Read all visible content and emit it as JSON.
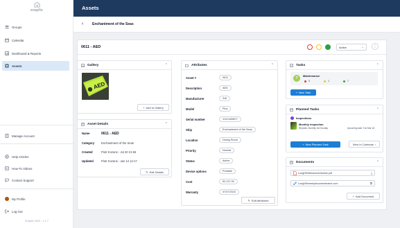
{
  "brand": {
    "name": "snapfix"
  },
  "sidebar": {
    "items": [
      {
        "label": "Groups",
        "icon": "groups-icon"
      },
      {
        "label": "Calendar",
        "icon": "calendar-icon"
      },
      {
        "label": "Dashboard & Reports",
        "icon": "dashboard-icon"
      },
      {
        "label": "Assets",
        "icon": "assets-icon",
        "active": true
      }
    ],
    "bottom_items": [
      {
        "label": "Manage Account",
        "icon": "building-icon"
      },
      {
        "label": "Help Articles",
        "icon": "help-icon"
      },
      {
        "label": "How-To Videos",
        "icon": "video-icon"
      },
      {
        "label": "Contact Support",
        "icon": "support-icon"
      },
      {
        "label": "My Profile",
        "icon": "avatar"
      },
      {
        "label": "Log Out",
        "icon": "logout-icon"
      }
    ],
    "version": "Snapfix 2023 - 1.1.7"
  },
  "header": {
    "title": "Assets"
  },
  "breadcrumb": {
    "title": "Enchantment of the Seas"
  },
  "asset": {
    "id": "0611 - AED",
    "status": "Active",
    "status_colors": [
      "#e53935",
      "#f5c518",
      "#2e9e44"
    ]
  },
  "gallery": {
    "title": "Gallery",
    "image_label": "AED",
    "add_button": "Add to Gallery"
  },
  "details": {
    "title": "Asset Details",
    "rows": [
      {
        "key": "Name",
        "value": "0611 - AED"
      },
      {
        "key": "Category",
        "value": "Enchantment of the Seas"
      },
      {
        "key": "Created",
        "value": "Piotr Kozans - Jul 20 21:56"
      },
      {
        "key": "Updated",
        "value": "Piotr Kozans - Jan 12 12:17"
      }
    ],
    "edit_button": "Edit Details"
  },
  "attributes": {
    "title": "Attributes",
    "rows": [
      {
        "key": "Asset #",
        "value": "0611"
      },
      {
        "key": "Description",
        "value": "AED"
      },
      {
        "key": "Manufacturer",
        "value": "Zoll"
      },
      {
        "key": "Model",
        "value": "Plus"
      },
      {
        "key": "Serial number",
        "value": "X11C489677"
      },
      {
        "key": "Ship",
        "value": "Enchantment of the Seas"
      },
      {
        "key": "Location",
        "value": "Dining Room"
      },
      {
        "key": "Priority",
        "value": "Normal"
      },
      {
        "key": "Status",
        "value": "Active"
      },
      {
        "key": "Device options",
        "value": "Portable"
      },
      {
        "key": "Cost",
        "value": "€2,137.90"
      },
      {
        "key": "Warranty",
        "value": "07/07/2023"
      }
    ],
    "edit_button": "Edit Attributes"
  },
  "tasks": {
    "title": "Tasks",
    "card_title": "Maintenance",
    "counts": [
      {
        "color": "#e53935",
        "value": "0"
      },
      {
        "color": "#f5c518",
        "value": "1"
      },
      {
        "color": "#2e9e44",
        "value": "7"
      }
    ],
    "new_button": "New Task"
  },
  "planned": {
    "title": "Planned Tasks",
    "group": "Inspections",
    "item_title": "Monthly inspection",
    "item_repeat": "Repeats: Monthly 3rd Sunday",
    "item_upcoming": "Upcoming task: Tue Mar 18",
    "new_button": "New Planned Task",
    "view_button": "View In Calendar"
  },
  "documents": {
    "title": "Documents",
    "files": [
      {
        "name": "LongDEMIdocumentname.pdf",
        "action": "download-icon"
      },
      {
        "name": "LongWformetydocumentname.com",
        "action": "external-link-icon"
      }
    ],
    "add_button": "Add Document"
  }
}
